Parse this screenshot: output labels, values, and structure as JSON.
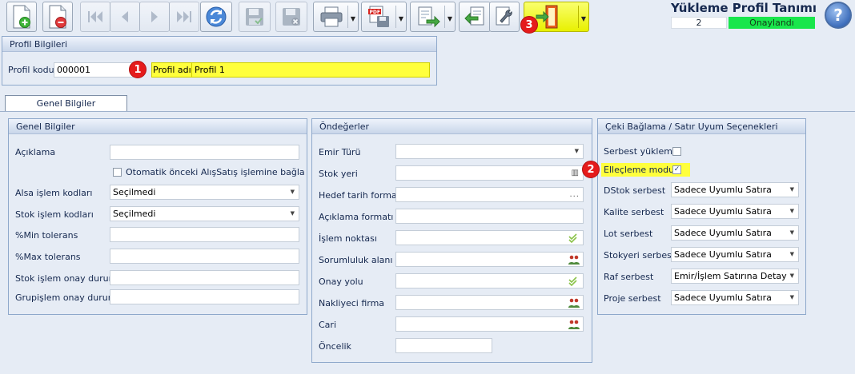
{
  "header": {
    "title": "Yükleme Profil Tanımı",
    "record_count": "2",
    "status": "Onaylandı"
  },
  "toolbar": {
    "icons": [
      "new-document-icon",
      "delete-document-icon",
      "first-record-icon",
      "previous-record-icon",
      "next-record-icon",
      "last-record-icon",
      "refresh-icon",
      "save-icon",
      "save-close-icon",
      "print-icon",
      "pdf-export-icon",
      "export-icon",
      "back-arrow-icon",
      "tools-icon",
      "exit-door-icon",
      "help-icon"
    ],
    "help_label": "?"
  },
  "profile_info": {
    "header": "Profil Bilgileri",
    "code_label": "Profil kodu",
    "code_value": "000001",
    "name_label": "Profil adı",
    "name_value": "Profil 1"
  },
  "tabs": [
    {
      "label": "Genel Bilgiler"
    }
  ],
  "general": {
    "header": "Genel Bilgiler",
    "aciklama_label": "Açıklama",
    "aciklama_value": "",
    "auto_check_label": "Otomatik önceki AlışSatış işlemine bağla",
    "alsa_label": "Alsa işlem kodları",
    "alsa_value": "Seçilmedi",
    "stok_kod_label": "Stok işlem kodları",
    "stok_kod_value": "Seçilmedi",
    "min_tol_label": "%Min tolerans",
    "max_tol_label": "%Max tolerans",
    "stok_onay_label": "Stok işlem onay durumu",
    "grup_onay_label": "Grupişlem onay durumu"
  },
  "defaults": {
    "header": "Öndeğerler",
    "emir_turu_label": "Emir Türü",
    "stok_yeri_label": "Stok yeri",
    "hedef_tarih_label": "Hedef tarih formatı",
    "aciklama_format_label": "Açıklama formatı",
    "islem_noktasi_label": "İşlem noktası",
    "sorumluluk_label": "Sorumluluk alanı",
    "onay_yolu_label": "Onay yolu",
    "nakliyeci_label": "Nakliyeci firma",
    "cari_label": "Cari",
    "oncelik_label": "Öncelik",
    "edit_button_label": "..."
  },
  "cheque": {
    "header": "Çeki Bağlama / Satır Uyum Seçenekleri",
    "serbest_yukleme_label": "Serbest yükleme",
    "ellecleme_label": "Elleçleme modu",
    "dstok_label": "DStok serbest",
    "dstok_value": "Sadece Uyumlu Satıra",
    "kalite_label": "Kalite serbest",
    "kalite_value": "Sadece Uyumlu Satıra",
    "lot_label": "Lot serbest",
    "lot_value": "Sadece Uyumlu Satıra",
    "stokyeri_label": "Stokyeri serbest",
    "stokyeri_value": "Sadece Uyumlu Satıra",
    "raf_label": "Raf serbest",
    "raf_value": "Emir/İşlem Satırına Detay",
    "proje_label": "Proje serbest",
    "proje_value": "Sadece Uyumlu Satıra"
  },
  "markers": [
    "1",
    "2",
    "3"
  ],
  "colors": {
    "highlight_yellow": "#ffff3c",
    "status_green": "#19e64c",
    "marker_red": "#e51b1b",
    "panel_border": "#8ea8cb"
  }
}
